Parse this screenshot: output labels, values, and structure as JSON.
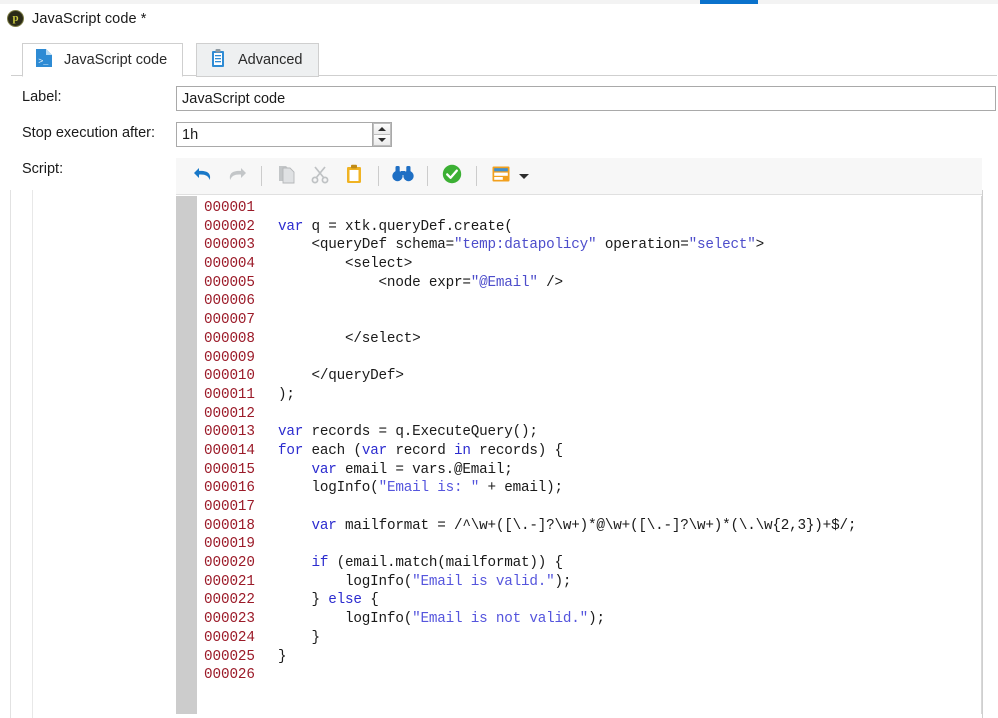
{
  "window": {
    "icon": "adobe-campaign-icon",
    "title": "JavaScript code *"
  },
  "tabs": [
    {
      "id": "javascript-code",
      "label": "JavaScript code",
      "icon": "script-file-icon",
      "active": true
    },
    {
      "id": "advanced",
      "label": "Advanced",
      "icon": "clipboard-icon",
      "active": false
    }
  ],
  "fields": {
    "label": {
      "caption": "Label:",
      "value": "JavaScript code",
      "placeholder": ""
    },
    "stop_execution": {
      "caption": "Stop execution after:",
      "value": "1h",
      "placeholder": ""
    },
    "script": {
      "caption": "Script:"
    }
  },
  "toolbar": {
    "buttons": [
      {
        "name": "undo-icon",
        "title": "Undo",
        "enabled": true
      },
      {
        "name": "redo-icon",
        "title": "Redo",
        "enabled": false
      },
      {
        "name": "copy-icon",
        "title": "Copy",
        "enabled": false
      },
      {
        "name": "cut-icon",
        "title": "Cut",
        "enabled": false
      },
      {
        "name": "paste-icon",
        "title": "Paste",
        "enabled": true
      },
      {
        "name": "find-binoculars-icon",
        "title": "Find",
        "enabled": true
      },
      {
        "name": "validate-check-icon",
        "title": "Check syntax",
        "enabled": true
      },
      {
        "name": "insert-form-icon",
        "title": "Insert",
        "enabled": true
      }
    ]
  },
  "editor": {
    "colors": {
      "lineno": "#9b1a28",
      "keyword": "#2c2ccf",
      "string": "#5555dd",
      "text": "#1a1a1a",
      "fold_margin": "#cccccc",
      "background": "#ffffff"
    },
    "lines": [
      {
        "no": "000001",
        "tokens": []
      },
      {
        "no": "000002",
        "tokens": [
          {
            "t": "var",
            "c": "kw"
          },
          {
            "t": " q = xtk.queryDef.create(",
            "c": ""
          }
        ]
      },
      {
        "no": "000003",
        "tokens": [
          {
            "t": "    <queryDef schema=",
            "c": ""
          },
          {
            "t": "\"temp:datapolicy\"",
            "c": "xmlstr"
          },
          {
            "t": " operation=",
            "c": ""
          },
          {
            "t": "\"select\"",
            "c": "xmlstr"
          },
          {
            "t": ">",
            "c": ""
          }
        ]
      },
      {
        "no": "000004",
        "tokens": [
          {
            "t": "        <select>",
            "c": ""
          }
        ]
      },
      {
        "no": "000005",
        "tokens": [
          {
            "t": "            <node expr=",
            "c": ""
          },
          {
            "t": "\"@Email\"",
            "c": "xmlstr"
          },
          {
            "t": " />",
            "c": ""
          }
        ]
      },
      {
        "no": "000006",
        "tokens": []
      },
      {
        "no": "000007",
        "tokens": []
      },
      {
        "no": "000008",
        "tokens": [
          {
            "t": "        </select>",
            "c": ""
          }
        ]
      },
      {
        "no": "000009",
        "tokens": []
      },
      {
        "no": "000010",
        "tokens": [
          {
            "t": "    </queryDef>",
            "c": ""
          }
        ]
      },
      {
        "no": "000011",
        "tokens": [
          {
            "t": ");",
            "c": ""
          }
        ]
      },
      {
        "no": "000012",
        "tokens": []
      },
      {
        "no": "000013",
        "tokens": [
          {
            "t": "var",
            "c": "kw"
          },
          {
            "t": " records = q.ExecuteQuery();",
            "c": ""
          }
        ]
      },
      {
        "no": "000014",
        "tokens": [
          {
            "t": "for",
            "c": "kw"
          },
          {
            "t": " each (",
            "c": ""
          },
          {
            "t": "var",
            "c": "kw"
          },
          {
            "t": " record ",
            "c": ""
          },
          {
            "t": "in",
            "c": "kw"
          },
          {
            "t": " records) {",
            "c": ""
          }
        ]
      },
      {
        "no": "000015",
        "tokens": [
          {
            "t": "    ",
            "c": ""
          },
          {
            "t": "var",
            "c": "kw"
          },
          {
            "t": " email = vars.@Email;",
            "c": ""
          }
        ]
      },
      {
        "no": "000016",
        "tokens": [
          {
            "t": "    logInfo(",
            "c": ""
          },
          {
            "t": "\"Email is: \"",
            "c": "str"
          },
          {
            "t": " + email);",
            "c": ""
          }
        ]
      },
      {
        "no": "000017",
        "tokens": []
      },
      {
        "no": "000018",
        "tokens": [
          {
            "t": "    ",
            "c": ""
          },
          {
            "t": "var",
            "c": "kw"
          },
          {
            "t": " mailformat = /^\\w+([\\.-]?\\w+)*@\\w+([\\.-]?\\w+)*(\\.\\w{2,3})+$/;",
            "c": ""
          }
        ]
      },
      {
        "no": "000019",
        "tokens": []
      },
      {
        "no": "000020",
        "tokens": [
          {
            "t": "    ",
            "c": ""
          },
          {
            "t": "if",
            "c": "kw"
          },
          {
            "t": " (email.match(mailformat)) {",
            "c": ""
          }
        ]
      },
      {
        "no": "000021",
        "tokens": [
          {
            "t": "        logInfo(",
            "c": ""
          },
          {
            "t": "\"Email is valid.\"",
            "c": "str"
          },
          {
            "t": ");",
            "c": ""
          }
        ]
      },
      {
        "no": "000022",
        "tokens": [
          {
            "t": "    } ",
            "c": ""
          },
          {
            "t": "else",
            "c": "kw"
          },
          {
            "t": " {",
            "c": ""
          }
        ]
      },
      {
        "no": "000023",
        "tokens": [
          {
            "t": "        logInfo(",
            "c": ""
          },
          {
            "t": "\"Email is not valid.\"",
            "c": "str"
          },
          {
            "t": ");",
            "c": ""
          }
        ]
      },
      {
        "no": "000024",
        "tokens": [
          {
            "t": "    }",
            "c": ""
          }
        ]
      },
      {
        "no": "000025",
        "tokens": [
          {
            "t": "}",
            "c": ""
          }
        ]
      },
      {
        "no": "000026",
        "tokens": []
      }
    ]
  }
}
